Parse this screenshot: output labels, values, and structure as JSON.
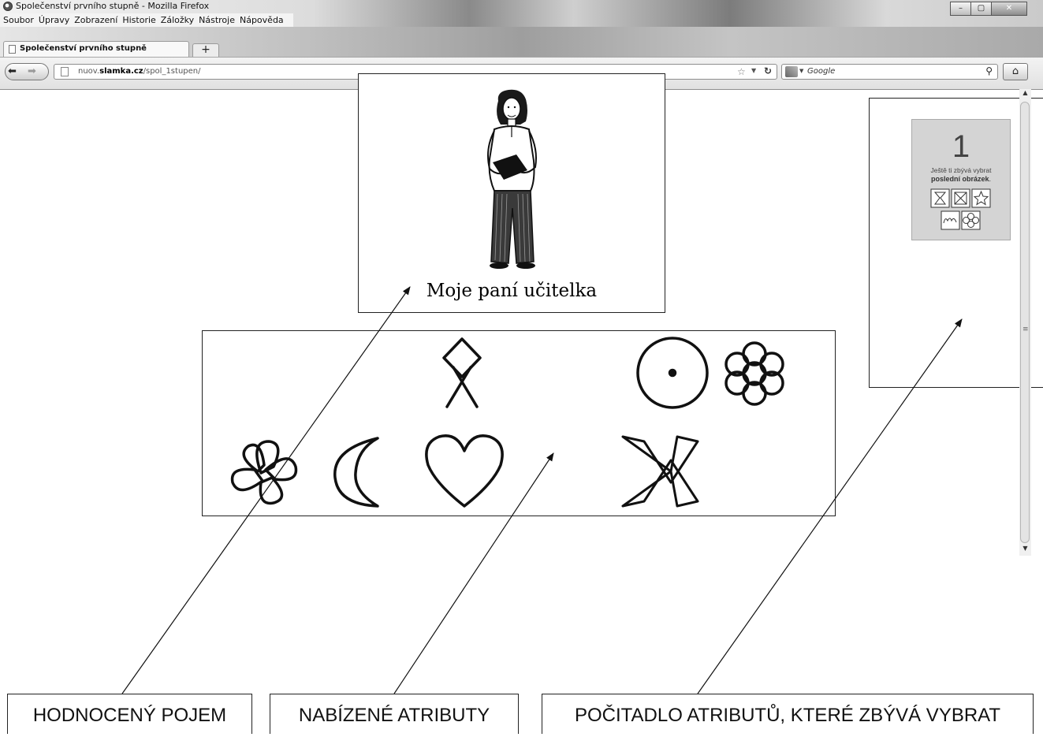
{
  "window": {
    "title": "Společenství prvního stupně - Mozilla Firefox",
    "buttons": {
      "minimize": "–",
      "maximize": "▢",
      "close": "✕"
    }
  },
  "menu": {
    "items": [
      {
        "label": "Soubor"
      },
      {
        "label": "Úpravy"
      },
      {
        "label": "Zobrazení"
      },
      {
        "label": "Historie"
      },
      {
        "label": "Záložky"
      },
      {
        "label": "Nástroje"
      },
      {
        "label": "Nápověda"
      }
    ]
  },
  "tab": {
    "label": "Společenství prvního stupně",
    "new_tab_label": "+"
  },
  "navigation": {
    "url_prefix": "nuov.",
    "url_domain": "slamka.cz",
    "url_path": "/spol_1stupen/",
    "search_engine": "Google",
    "icons": {
      "back": "back-icon",
      "forward": "forward-icon",
      "reload": "reload-icon",
      "home": "home-icon",
      "bookmark": "star-icon",
      "search": "magnifier-icon"
    }
  },
  "concept": {
    "label": "Moje paní učitelka",
    "image": "teacher-with-book-illustration"
  },
  "attributes": {
    "row1": [
      "knot-diamond-symbol",
      "circle-dot-symbol",
      "flower-symbol"
    ],
    "row2": [
      "pinwheel-flower-symbol",
      "crescent-moon-symbol",
      "heart-symbol",
      "x-cross-symbol"
    ]
  },
  "counter": {
    "number": "1",
    "line1": "Ještě ti zbývá vybrat",
    "line2_bold": "poslední obrázek",
    "line2_end": ".",
    "icons": [
      "hourglass-icon",
      "crossed-box-icon",
      "star-icon",
      "wave-icon",
      "clover-icon"
    ]
  },
  "callouts": {
    "concept": "HODNOCENÝ POJEM",
    "attributes": "NABÍZENÉ ATRIBUTY",
    "counter": "POČITADLO ATRIBUTŮ, KTERÉ ZBÝVÁ VYBRAT"
  }
}
